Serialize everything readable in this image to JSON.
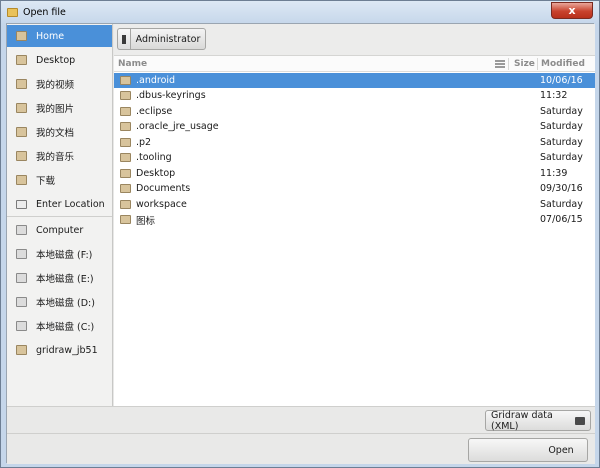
{
  "window": {
    "title": "Open file",
    "close_glyph": "x"
  },
  "sidebar": {
    "items": [
      {
        "label": "Home",
        "icon": "home-icon"
      },
      {
        "label": "Desktop",
        "icon": "desktop-icon"
      },
      {
        "label": "我的视频",
        "icon": "videos-folder-icon"
      },
      {
        "label": "我的图片",
        "icon": "pictures-folder-icon"
      },
      {
        "label": "我的文档",
        "icon": "documents-folder-icon"
      },
      {
        "label": "我的音乐",
        "icon": "music-folder-icon"
      },
      {
        "label": "下载",
        "icon": "downloads-folder-icon"
      },
      {
        "label": "Enter Location",
        "icon": "location-icon"
      }
    ],
    "devices": [
      {
        "label": "Computer",
        "icon": "computer-icon"
      },
      {
        "label": "本地磁盘 (F:)",
        "icon": "drive-icon"
      },
      {
        "label": "本地磁盘 (E:)",
        "icon": "drive-icon"
      },
      {
        "label": "本地磁盘 (D:)",
        "icon": "drive-icon"
      },
      {
        "label": "本地磁盘 (C:)",
        "icon": "drive-icon"
      },
      {
        "label": "gridraw_jb51",
        "icon": "folder-icon"
      }
    ]
  },
  "pathbar": {
    "current": "Administrator"
  },
  "filelist": {
    "columns": {
      "name": "Name",
      "size": "Size",
      "modified": "Modified"
    },
    "rows": [
      {
        "name": ".android",
        "size": "",
        "modified": "10/06/16",
        "selected": true
      },
      {
        "name": ".dbus-keyrings",
        "size": "",
        "modified": "11:32"
      },
      {
        "name": ".eclipse",
        "size": "",
        "modified": "Saturday"
      },
      {
        "name": ".oracle_jre_usage",
        "size": "",
        "modified": "Saturday"
      },
      {
        "name": ".p2",
        "size": "",
        "modified": "Saturday"
      },
      {
        "name": ".tooling",
        "size": "",
        "modified": "Saturday"
      },
      {
        "name": "Desktop",
        "size": "",
        "modified": "11:39"
      },
      {
        "name": "Documents",
        "size": "",
        "modified": "09/30/16"
      },
      {
        "name": "workspace",
        "size": "",
        "modified": "Saturday"
      },
      {
        "name": "图标",
        "size": "",
        "modified": "07/06/15"
      }
    ]
  },
  "filter": {
    "label": "Gridraw data (XML)"
  },
  "actions": {
    "open_label": "Open"
  },
  "colors": {
    "selection": "#4a90d9",
    "folder": "#d8c49c"
  }
}
